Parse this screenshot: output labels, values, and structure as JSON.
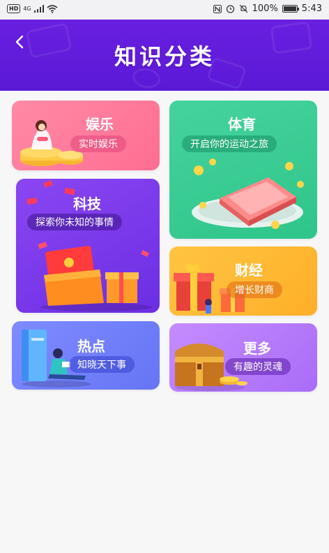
{
  "status_bar": {
    "hd": "HD",
    "network": "4G",
    "battery_text": "100%",
    "battery_level": 1.0,
    "time": "5:43"
  },
  "header": {
    "title": "知识分类",
    "back_icon": "chevron-left-icon"
  },
  "categories": [
    {
      "title": "娱乐",
      "subtitle": "实时娱乐"
    },
    {
      "title": "体育",
      "subtitle": "开启你的运动之旅"
    },
    {
      "title": "科技",
      "subtitle": "探索你未知的事情"
    },
    {
      "title": "财经",
      "subtitle": "增长财商"
    },
    {
      "title": "热点",
      "subtitle": "知晓天下事"
    },
    {
      "title": "更多",
      "subtitle": "有趣的灵魂"
    }
  ],
  "colors": {
    "header": "#5a19d6",
    "yule": "#ff6d93",
    "tiyu": "#2fc58a",
    "keji": "#6c2ee3",
    "caijing": "#ffae28",
    "redian": "#6675f5",
    "gengduo": "#a96cf8"
  }
}
